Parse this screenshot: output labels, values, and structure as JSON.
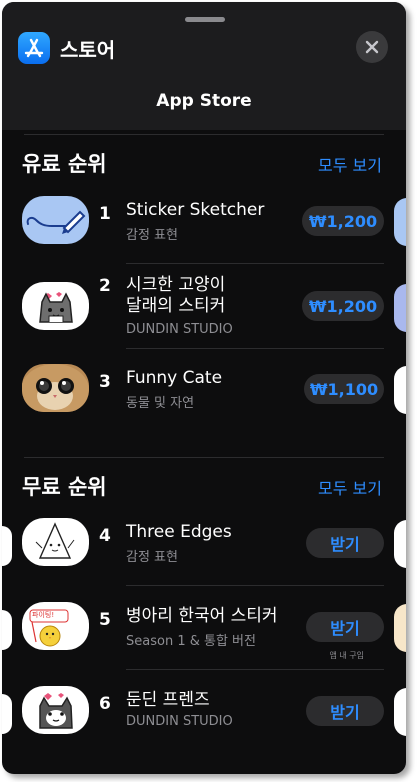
{
  "header": {
    "store_title": "스토어",
    "nav_title": "App Store"
  },
  "paid": {
    "title": "유료 순위",
    "see_all": "모두 보기",
    "items": [
      {
        "rank": "1",
        "name": "Sticker Sketcher",
        "subtitle": "감정 표현",
        "price": "₩1,200"
      },
      {
        "rank": "2",
        "name": "시크한 고양이\n달래의 스티커",
        "subtitle": "DUNDIN STUDIO",
        "price": "₩1,200"
      },
      {
        "rank": "3",
        "name": "Funny Cate",
        "subtitle": "동물 및 자연",
        "price": "₩1,100"
      }
    ]
  },
  "free": {
    "title": "무료 순위",
    "see_all": "모두 보기",
    "items": [
      {
        "rank": "4",
        "name": "Three Edges",
        "subtitle": "감정 표현",
        "button": "받기"
      },
      {
        "rank": "5",
        "name": "병아리 한국어 스티커",
        "subtitle": "Season 1 & 통합 버전",
        "button": "받기",
        "note": "앱 내 구입"
      },
      {
        "rank": "6",
        "name": "둔딘 프렌즈",
        "subtitle": "DUNDIN STUDIO",
        "button": "받기"
      }
    ]
  },
  "thumb_texts": {
    "chick_banner": "파이팅!"
  },
  "colors": {
    "accent": "#2e8dff",
    "background": "#0d0d0e",
    "button_bg": "#2c2c2e"
  }
}
